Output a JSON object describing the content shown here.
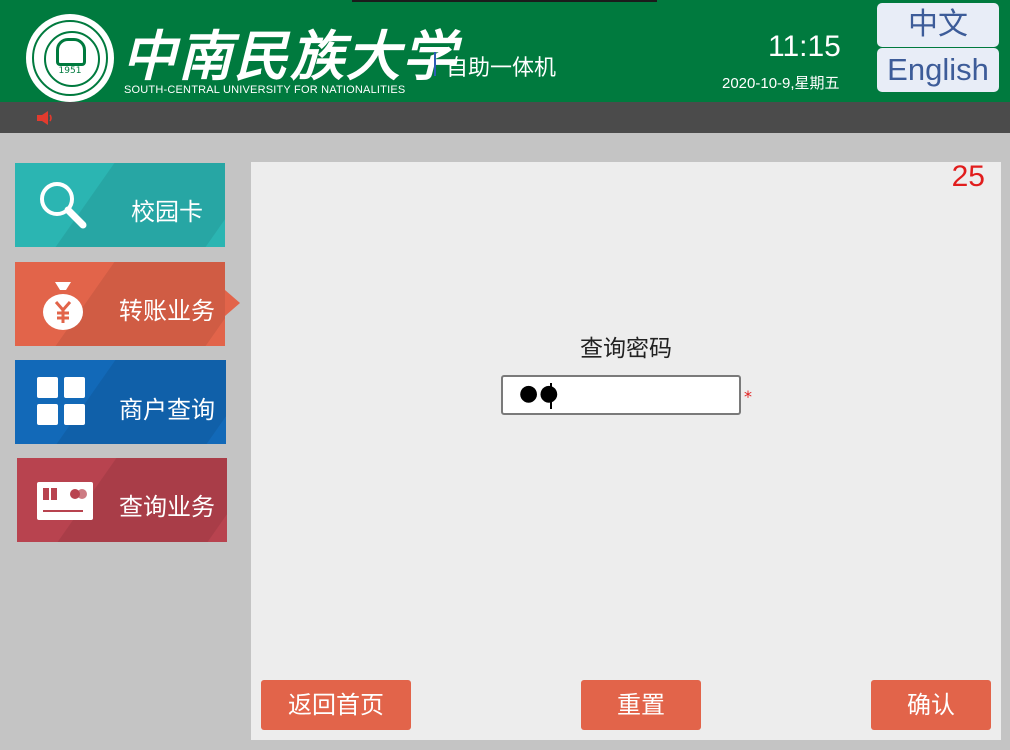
{
  "header": {
    "logo_year": "1951",
    "university_name_cn": "中南民族大学",
    "university_name_en": "SOUTH-CENTRAL UNIVERSITY FOR NATIONALITIES",
    "kiosk_title": "自助一体机",
    "time": "11:15",
    "date": "2020-10-9,星期五",
    "lang_zh": "中文",
    "lang_en": "English"
  },
  "toolbar": {
    "sound_icon": "speaker-icon"
  },
  "menu": {
    "items": [
      {
        "label": "校园卡",
        "icon": "search-icon",
        "color": "#2bb5b2"
      },
      {
        "label": "转账业务",
        "icon": "money-bag-icon",
        "color": "#e2644a",
        "selected": true
      },
      {
        "label": "商户查询",
        "icon": "grid-icon",
        "color": "#1269b8"
      },
      {
        "label": "查询业务",
        "icon": "bank-card-icon",
        "color": "#b8434f"
      }
    ]
  },
  "main": {
    "countdown": "25",
    "field_label": "查询密码",
    "password_value": "●●",
    "required_mark": "*"
  },
  "buttons": {
    "home": "返回首页",
    "reset": "重置",
    "confirm": "确认"
  },
  "colors": {
    "header_green": "#007a3e",
    "accent_orange": "#e2644a",
    "countdown_red": "#e11d1d"
  }
}
